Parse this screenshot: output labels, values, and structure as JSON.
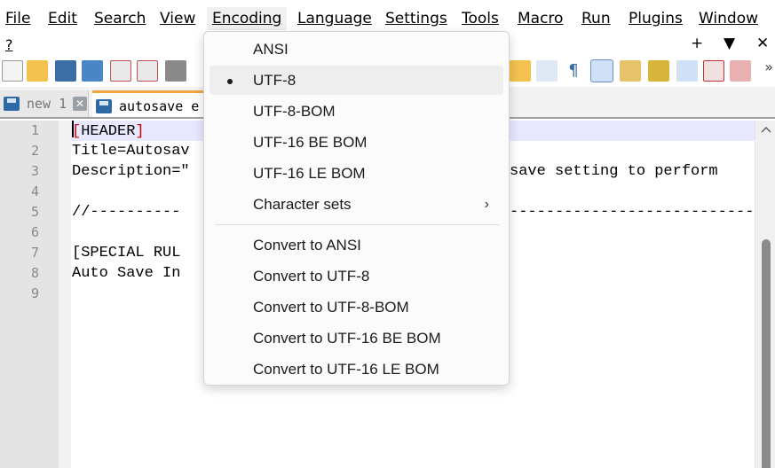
{
  "menubar": {
    "items": [
      "File",
      "Edit",
      "Search",
      "View",
      "Encoding",
      "Language",
      "Settings",
      "Tools",
      "Macro",
      "Run",
      "Plugins",
      "Window"
    ],
    "help": "?",
    "window_controls": [
      "+",
      "▼",
      "✕"
    ]
  },
  "toolbar": {
    "overflow": "»"
  },
  "tabs": [
    {
      "label": "new 1",
      "close": "✕"
    },
    {
      "label": "autosave e"
    }
  ],
  "editor": {
    "line_numbers": [
      "1",
      "2",
      "3",
      "4",
      "5",
      "6",
      "7",
      "8",
      "9"
    ],
    "lines": [
      {
        "open": "[",
        "text": "HEADER",
        "close": "]"
      },
      {
        "text": "Title=Autosav"
      },
      {
        "text": "Description=\"",
        "tail": "save setting to perform"
      },
      {
        "text": ""
      },
      {
        "text": "//----------",
        "tail": "----------------------------"
      },
      {
        "text": ""
      },
      {
        "text": "[SPECIAL RUL"
      },
      {
        "text": "Auto Save In"
      },
      {
        "text": ""
      }
    ]
  },
  "encoding_menu": {
    "items": [
      {
        "label": "ANSI"
      },
      {
        "label": "UTF-8",
        "selected": true
      },
      {
        "label": "UTF-8-BOM"
      },
      {
        "label": "UTF-16 BE BOM"
      },
      {
        "label": "UTF-16 LE BOM"
      },
      {
        "label": "Character sets",
        "submenu": "›"
      },
      {
        "label": "Convert to ANSI"
      },
      {
        "label": "Convert to UTF-8"
      },
      {
        "label": "Convert to UTF-8-BOM"
      },
      {
        "label": "Convert to UTF-16 BE BOM"
      },
      {
        "label": "Convert to UTF-16 LE BOM"
      }
    ]
  },
  "colors": {
    "accent_tab": "#f5a445",
    "current_line": "#e8e8ff",
    "bracket": "#cc0000"
  }
}
